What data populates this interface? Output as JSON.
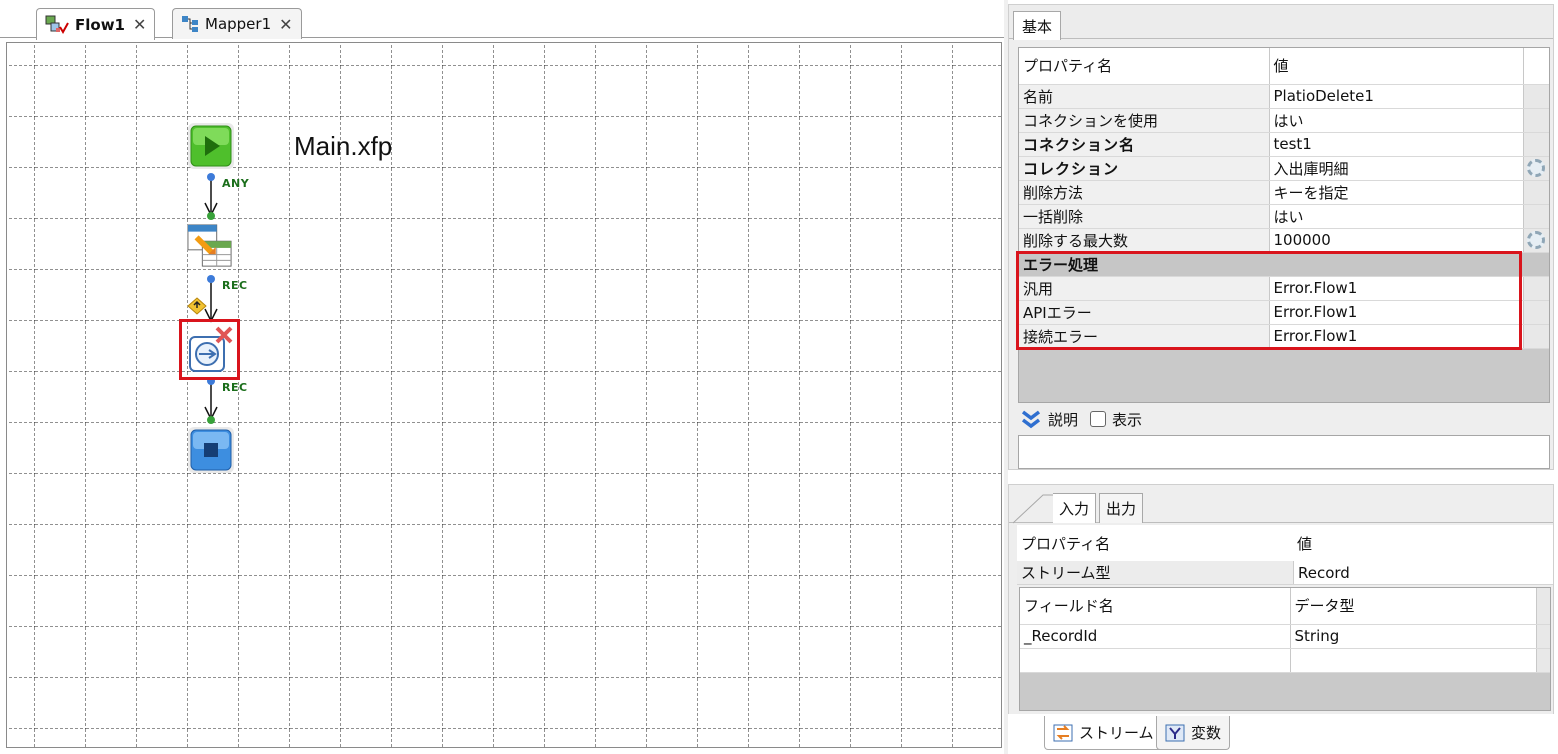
{
  "editor": {
    "tabs": [
      {
        "label": "Flow1",
        "close": "✕"
      },
      {
        "label": "Mapper1",
        "close": "✕"
      }
    ],
    "flow_title": "Main.xfp",
    "connections": [
      "ANY",
      "REC",
      "REC"
    ],
    "icons": [
      "start-icon",
      "mapper-icon",
      "platio-delete-icon",
      "end-icon"
    ]
  },
  "props": {
    "tab": "基本",
    "header": {
      "name": "プロパティ名",
      "value": "値"
    },
    "rows": [
      {
        "name": "名前",
        "value": "PlatioDelete1"
      },
      {
        "name": "コネクションを使用",
        "value": "はい"
      },
      {
        "name": "コネクション名",
        "value": "test1"
      },
      {
        "name": "コレクション",
        "value": "入出庫明細"
      },
      {
        "name": "削除方法",
        "value": "キーを指定"
      },
      {
        "name": "一括削除",
        "value": "はい"
      },
      {
        "name": "削除する最大数",
        "value": "100000"
      }
    ],
    "section": "エラー処理",
    "error_rows": [
      {
        "name": "汎用",
        "value": "Error.Flow1"
      },
      {
        "name": "APIエラー",
        "value": "Error.Flow1"
      },
      {
        "name": "接続エラー",
        "value": "Error.Flow1"
      }
    ],
    "desc_label": "説明",
    "show_label": "表示"
  },
  "stream": {
    "tabs": [
      "入力",
      "出力"
    ],
    "header": {
      "name": "プロパティ名",
      "value": "値"
    },
    "row": {
      "name": "ストリーム型",
      "value": "Record"
    },
    "field_header": {
      "name": "フィールド名",
      "type": "データ型"
    },
    "fields": [
      {
        "name": "_RecordId",
        "type": "String"
      }
    ]
  },
  "bottom_tabs": [
    "ストリーム",
    "変数"
  ],
  "colors": {
    "highlight": "#d9141c",
    "label_green": "#1b6e1b"
  }
}
